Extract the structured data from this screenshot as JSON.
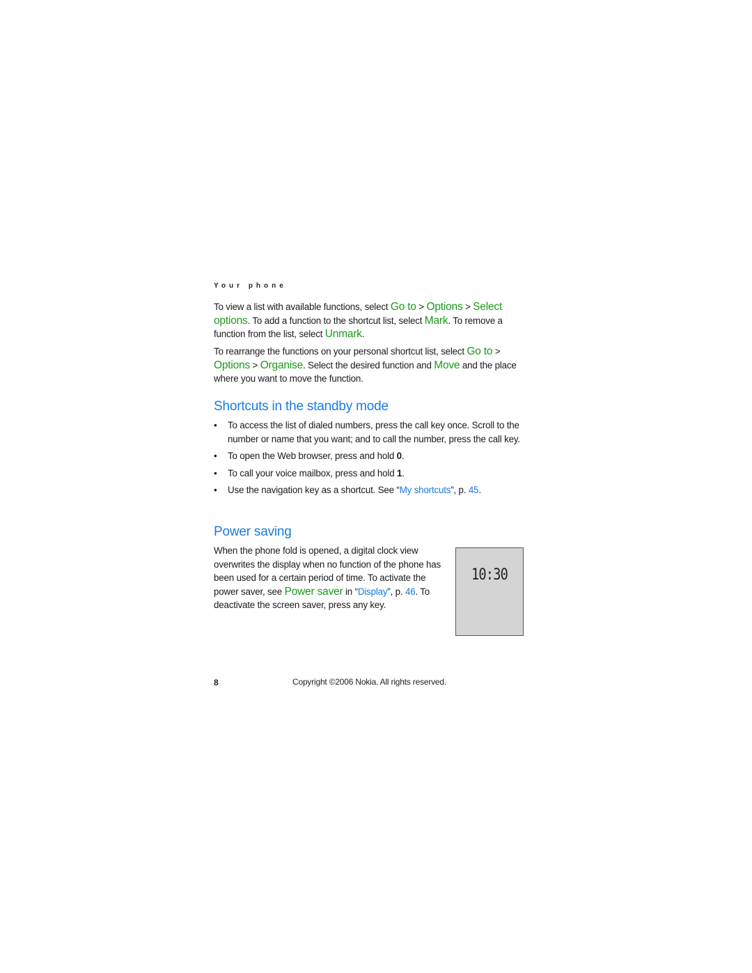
{
  "header": {
    "section_title": "Your phone"
  },
  "intro": {
    "p1": {
      "t1": "To view a list with available functions, select ",
      "goto": "Go to",
      "sep1": " > ",
      "options": "Options",
      "sep2": " > ",
      "select_options": "Select options",
      "t2": ". To add a function to the shortcut list, select ",
      "mark": "Mark",
      "t3": ". To remove a function from the list, select ",
      "unmark": "Unmark",
      "t4": "."
    },
    "p2": {
      "t1": "To rearrange the functions on your personal shortcut list, select ",
      "goto": "Go to",
      "sep1": " > ",
      "options": "Options",
      "sep2": " > ",
      "organise": "Organise",
      "t2": ". Select the desired function and ",
      "move": "Move",
      "t3": " and the place where you want to move the function."
    }
  },
  "shortcuts": {
    "heading": "Shortcuts in the standby mode",
    "bullet": "•",
    "items": [
      {
        "text": "To access the list of dialed numbers, press the call key once. Scroll to the number or name that you want; and to call the number, press the call key."
      },
      {
        "text": "To open the Web browser, press and hold ",
        "key": "0",
        "end": "."
      },
      {
        "text": "To call your voice mailbox, press and hold ",
        "key": "1",
        "end": "."
      },
      {
        "text": "Use the navigation key as a shortcut. See “",
        "link": "My shortcuts",
        "mid": "”, p. ",
        "page": "45",
        "end": "."
      }
    ]
  },
  "power": {
    "heading": "Power saving",
    "t1": "When the phone fold is opened, a digital clock view overwrites the display when no function of the phone has been used for a certain period of time. To activate the power saver, see ",
    "power_saver": "Power saver",
    "t2": " in “",
    "display_link": "Display",
    "t3": "”, p. ",
    "page": "46",
    "t4": ". To deactivate the screen saver, press any key.",
    "clock_time": "10:30"
  },
  "footer": {
    "page_number": "8",
    "copyright": "Copyright ©2006 Nokia. All rights reserved."
  }
}
